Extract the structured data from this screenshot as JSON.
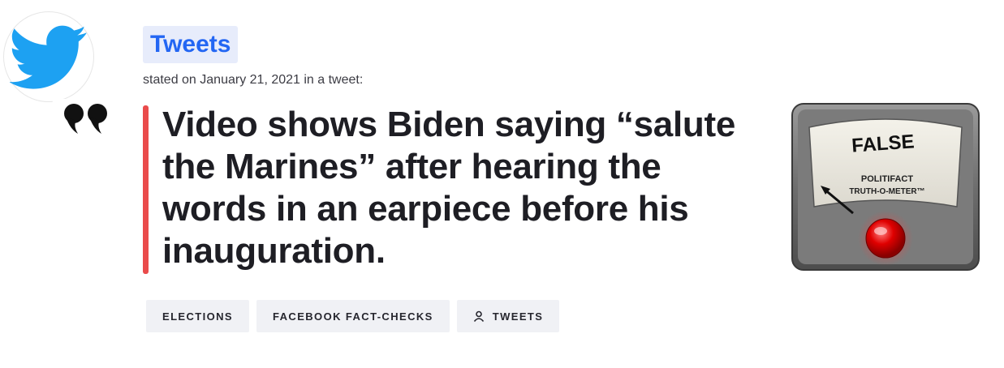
{
  "speaker": {
    "name": "Tweets",
    "avatar_icon": "twitter-bird-icon",
    "brand_color": "#1da1f2"
  },
  "statement": {
    "stated_line": "stated on January 21, 2021 in a tweet:",
    "quote_icon": "quote-marks-icon",
    "text": "Video shows Biden saying “salute the Marines” after hearing the words in an earpiece before his inauguration.",
    "accent_color": "#ea4b4b"
  },
  "ruling": {
    "label": "FALSE",
    "meter_line1": "POLITIFACT",
    "meter_line2": "TRUTH-O-METER™"
  },
  "tags": [
    {
      "label": "ELECTIONS",
      "icon": ""
    },
    {
      "label": "FACEBOOK FACT-CHECKS",
      "icon": ""
    },
    {
      "label": "TWEETS",
      "icon": "person-icon"
    }
  ]
}
